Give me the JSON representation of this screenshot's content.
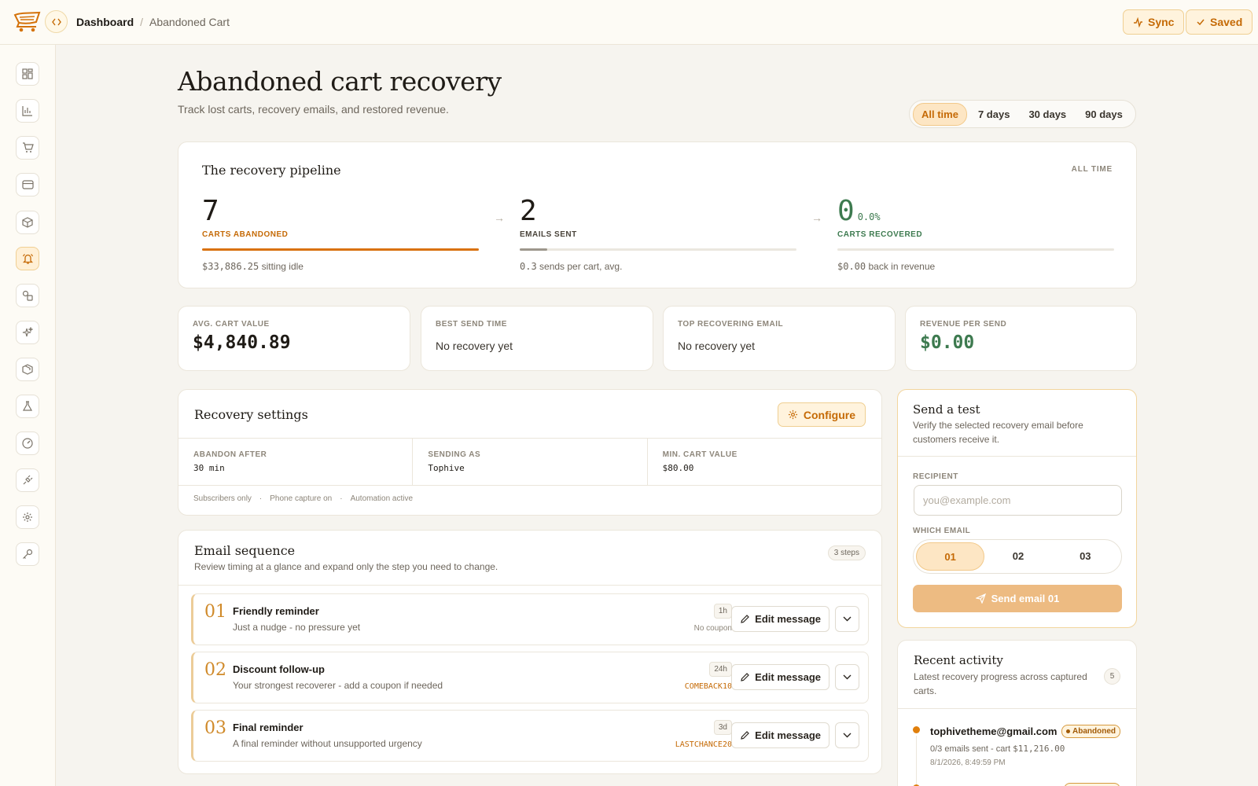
{
  "header": {
    "breadcrumb_root": "Dashboard",
    "breadcrumb_sep": "/",
    "breadcrumb_current": "Abandoned Cart",
    "sync_label": "Sync",
    "saved_label": "Saved"
  },
  "sidebar": {
    "items": [
      {
        "icon": "grid-icon"
      },
      {
        "icon": "bar-chart-icon"
      },
      {
        "icon": "cart-icon"
      },
      {
        "icon": "credit-card-icon"
      },
      {
        "icon": "box-icon"
      },
      {
        "icon": "bell-icon",
        "active": true
      },
      {
        "icon": "shapes-icon"
      },
      {
        "icon": "sparkles-icon"
      },
      {
        "icon": "package-icon"
      },
      {
        "icon": "flask-icon"
      },
      {
        "icon": "gauge-icon"
      },
      {
        "icon": "plug-icon"
      },
      {
        "icon": "gear-icon"
      },
      {
        "icon": "key-icon"
      }
    ]
  },
  "page": {
    "title": "Abandoned cart recovery",
    "subtitle": "Track lost carts, recovery emails, and restored revenue."
  },
  "range": {
    "options": [
      "All time",
      "7 days",
      "30 days",
      "90 days"
    ],
    "selected": "All time"
  },
  "pipeline": {
    "title": "The recovery pipeline",
    "period": "ALL TIME",
    "stages": [
      {
        "value": "7",
        "label": "CARTS ABANDONED",
        "note_value": "$33,886.25",
        "note_text": "sitting idle",
        "progress": 1.0
      },
      {
        "value": "2",
        "label": "EMAILS SENT",
        "note_value": "0.3",
        "note_text": "sends per cart, avg.",
        "progress": 0.1
      },
      {
        "value": "0",
        "pct": "0.0%",
        "label": "CARTS RECOVERED",
        "note_value": "$0.00",
        "note_text": "back in revenue",
        "progress": 0.0
      }
    ]
  },
  "stats": {
    "avg_cart": {
      "label": "AVG. CART VALUE",
      "value": "$4,840.89"
    },
    "best_send": {
      "label": "BEST SEND TIME",
      "value": "No recovery yet"
    },
    "top_email": {
      "label": "TOP RECOVERING EMAIL",
      "value": "No recovery yet"
    },
    "rev_per_send": {
      "label": "REVENUE PER SEND",
      "value": "$0.00"
    }
  },
  "settings": {
    "title": "Recovery settings",
    "configure_label": "Configure",
    "abandon_label": "ABANDON AFTER",
    "abandon_value": "30 min",
    "sending_label": "SENDING AS",
    "sending_value": "Tophive",
    "min_label": "MIN. CART VALUE",
    "min_value": "$80.00",
    "tag1": "Subscribers only",
    "tag2": "Phone capture on",
    "tag3": "Automation active",
    "dot": "·"
  },
  "sequence": {
    "title": "Email sequence",
    "subtitle": "Review timing at a glance and expand only the step you need to change.",
    "count": "3 steps",
    "edit_label": "Edit message",
    "steps": [
      {
        "num": "01",
        "name": "Friendly reminder",
        "desc": "Just a nudge - no pressure yet",
        "delay": "1h",
        "coupon": "No coupon"
      },
      {
        "num": "02",
        "name": "Discount follow-up",
        "desc": "Your strongest recoverer - add a coupon if needed",
        "delay": "24h",
        "coupon": "COMEBACK10"
      },
      {
        "num": "03",
        "name": "Final reminder",
        "desc": "A final reminder without unsupported urgency",
        "delay": "3d",
        "coupon": "LASTCHANCE20"
      }
    ]
  },
  "send_test": {
    "title": "Send a test",
    "desc": "Verify the selected recovery email before customers receive it.",
    "recipient_label": "RECIPIENT",
    "recipient_placeholder": "you@example.com",
    "which_label": "WHICH EMAIL",
    "options": [
      "01",
      "02",
      "03"
    ],
    "selected": "01",
    "send_label": "Send email 01"
  },
  "activity": {
    "title": "Recent activity",
    "desc": "Latest recovery progress across captured carts.",
    "count": "5",
    "items": [
      {
        "email": "tophivetheme@gmail.com",
        "status": "Abandoned",
        "meta_prefix": "0/3 emails sent - cart",
        "meta_value": "$11,216.00",
        "time": "8/1/2026, 8:49:59 PM"
      }
    ]
  },
  "colors": {
    "accent": "#c56a06",
    "progress_abandoned": "#d9720f",
    "progress_sent": "#9d978c",
    "recovered_green": "#3d7a4f"
  }
}
